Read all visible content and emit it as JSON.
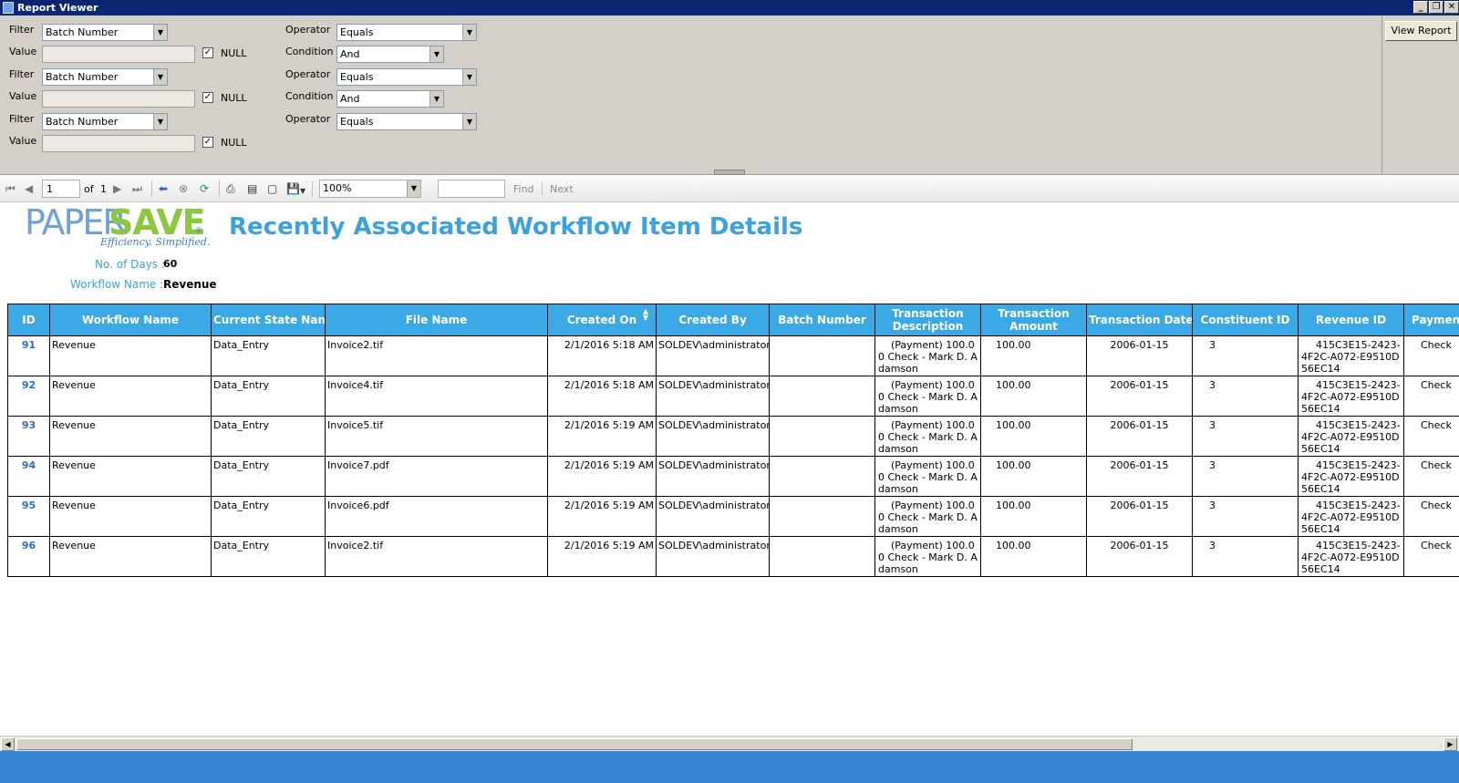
{
  "window": {
    "title": "Report Viewer",
    "minimize": "_",
    "restore": "❐",
    "close": "✕"
  },
  "params": {
    "rows": [
      {
        "filter_label": "Filter",
        "filter_value": "Batch Number",
        "operator_label": "Operator",
        "operator_value": "Equals",
        "value_label": "Value",
        "null_label": "NULL",
        "null_checked": true,
        "condition_label": "Condition",
        "condition_value": "And"
      },
      {
        "filter_label": "Filter",
        "filter_value": "Batch Number",
        "operator_label": "Operator",
        "operator_value": "Equals",
        "value_label": "Value",
        "null_label": "NULL",
        "null_checked": true,
        "condition_label": "Condition",
        "condition_value": "And"
      },
      {
        "filter_label": "Filter",
        "filter_value": "Batch Number",
        "operator_label": "Operator",
        "operator_value": "Equals",
        "value_label": "Value",
        "null_label": "NULL",
        "null_checked": true
      }
    ],
    "view_report_label": "View Report"
  },
  "toolbar": {
    "page_current": "1",
    "page_of": "of",
    "page_total": "1",
    "zoom": "100%",
    "find_text": "",
    "find_label": "Find",
    "next_label": "Next"
  },
  "report": {
    "logo_paper": "PAPER",
    "logo_save": "SAVE",
    "logo_reg": "®",
    "logo_tagline": "Efficiency. Simplified.",
    "title": "Recently Associated Workflow Item Details",
    "days_label": "No. of Days :",
    "days_value": "60",
    "workflow_label": "Workflow Name :",
    "workflow_value": "Revenue",
    "columns": [
      "ID",
      "Workflow Name",
      "Current State Name",
      "File Name",
      "Created On",
      "Created By",
      "Batch Number",
      "Transaction Description",
      "Transaction Amount",
      "Transaction Date",
      "Constituent ID",
      "Revenue ID",
      "Payment"
    ],
    "rows": [
      {
        "id": "91",
        "workflow": "Revenue",
        "state": "Data_Entry",
        "file": "Invoice2.tif",
        "created_on": "2/1/2016 5:18 AM",
        "created_by": "SOLDEV\\administrator",
        "batch": "",
        "desc": "(Payment) 100.00 Check - Mark D. Adamson",
        "amount": "100.00",
        "date": "2006-01-15",
        "constituent": "3",
        "revenue_id": "415C3E15-2423-4F2C-A072-E9510D56EC14",
        "payment": "Check"
      },
      {
        "id": "92",
        "workflow": "Revenue",
        "state": "Data_Entry",
        "file": "Invoice4.tif",
        "created_on": "2/1/2016 5:18 AM",
        "created_by": "SOLDEV\\administrator",
        "batch": "",
        "desc": "(Payment) 100.00 Check - Mark D. Adamson",
        "amount": "100.00",
        "date": "2006-01-15",
        "constituent": "3",
        "revenue_id": "415C3E15-2423-4F2C-A072-E9510D56EC14",
        "payment": "Check"
      },
      {
        "id": "93",
        "workflow": "Revenue",
        "state": "Data_Entry",
        "file": "Invoice5.tif",
        "created_on": "2/1/2016 5:19 AM",
        "created_by": "SOLDEV\\administrator",
        "batch": "",
        "desc": "(Payment) 100.00 Check - Mark D. Adamson",
        "amount": "100.00",
        "date": "2006-01-15",
        "constituent": "3",
        "revenue_id": "415C3E15-2423-4F2C-A072-E9510D56EC14",
        "payment": "Check"
      },
      {
        "id": "94",
        "workflow": "Revenue",
        "state": "Data_Entry",
        "file": "Invoice7.pdf",
        "created_on": "2/1/2016 5:19 AM",
        "created_by": "SOLDEV\\administrator",
        "batch": "",
        "desc": "(Payment) 100.00 Check - Mark D. Adamson",
        "amount": "100.00",
        "date": "2006-01-15",
        "constituent": "3",
        "revenue_id": "415C3E15-2423-4F2C-A072-E9510D56EC14",
        "payment": "Check"
      },
      {
        "id": "95",
        "workflow": "Revenue",
        "state": "Data_Entry",
        "file": "Invoice6.pdf",
        "created_on": "2/1/2016 5:19 AM",
        "created_by": "SOLDEV\\administrator",
        "batch": "",
        "desc": "(Payment) 100.00 Check - Mark D. Adamson",
        "amount": "100.00",
        "date": "2006-01-15",
        "constituent": "3",
        "revenue_id": "415C3E15-2423-4F2C-A072-E9510D56EC14",
        "payment": "Check"
      },
      {
        "id": "96",
        "workflow": "Revenue",
        "state": "Data_Entry",
        "file": "Invoice2.tif",
        "created_on": "2/1/2016 5:19 AM",
        "created_by": "SOLDEV\\administrator",
        "batch": "",
        "desc": "(Payment) 100.00 Check - Mark D. Adamson",
        "amount": "100.00",
        "date": "2006-01-15",
        "constituent": "3",
        "revenue_id": "415C3E15-2423-4F2C-A072-E9510D56EC14",
        "payment": "Check"
      }
    ]
  },
  "colors": {
    "header_bg": "#3aa9e6",
    "title_blue": "#3aa2e0",
    "logo_green": "#8dc63f",
    "status_blue": "#3a86d6"
  }
}
